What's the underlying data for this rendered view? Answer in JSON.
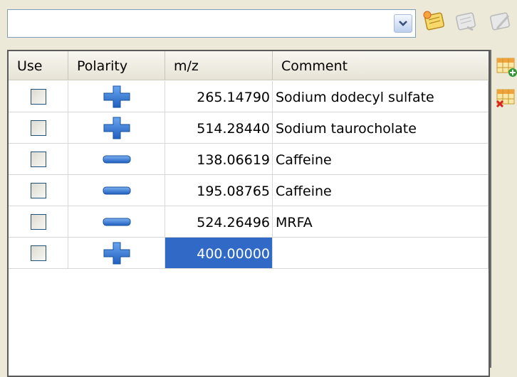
{
  "combo": {
    "value": ""
  },
  "icons": {
    "dropdown": "chevron-down-icon",
    "tool_new": "note-star-icon",
    "tool_disabled_1": "note-disabled-icon",
    "tool_disabled_2": "edit-disabled-icon",
    "add_row": "grid-add-icon",
    "delete_row": "grid-delete-icon",
    "positive": "plus-icon",
    "negative": "minus-icon"
  },
  "colors": {
    "polarity_blue": "#2f6fd0",
    "selection": "#3169c6"
  },
  "table": {
    "columns": [
      "Use",
      "Polarity",
      "m/z",
      "Comment"
    ],
    "rows": [
      {
        "use": false,
        "polarity": "positive",
        "mz": "265.14790",
        "comment": "Sodium dodecyl sulfate"
      },
      {
        "use": false,
        "polarity": "positive",
        "mz": "514.28440",
        "comment": "Sodium taurocholate"
      },
      {
        "use": false,
        "polarity": "negative",
        "mz": "138.06619",
        "comment": "Caffeine"
      },
      {
        "use": false,
        "polarity": "negative",
        "mz": "195.08765",
        "comment": "Caffeine"
      },
      {
        "use": false,
        "polarity": "negative",
        "mz": "524.26496",
        "comment": "MRFA"
      },
      {
        "use": false,
        "polarity": "positive",
        "mz": "400.00000",
        "comment": "",
        "selected": true
      }
    ]
  }
}
